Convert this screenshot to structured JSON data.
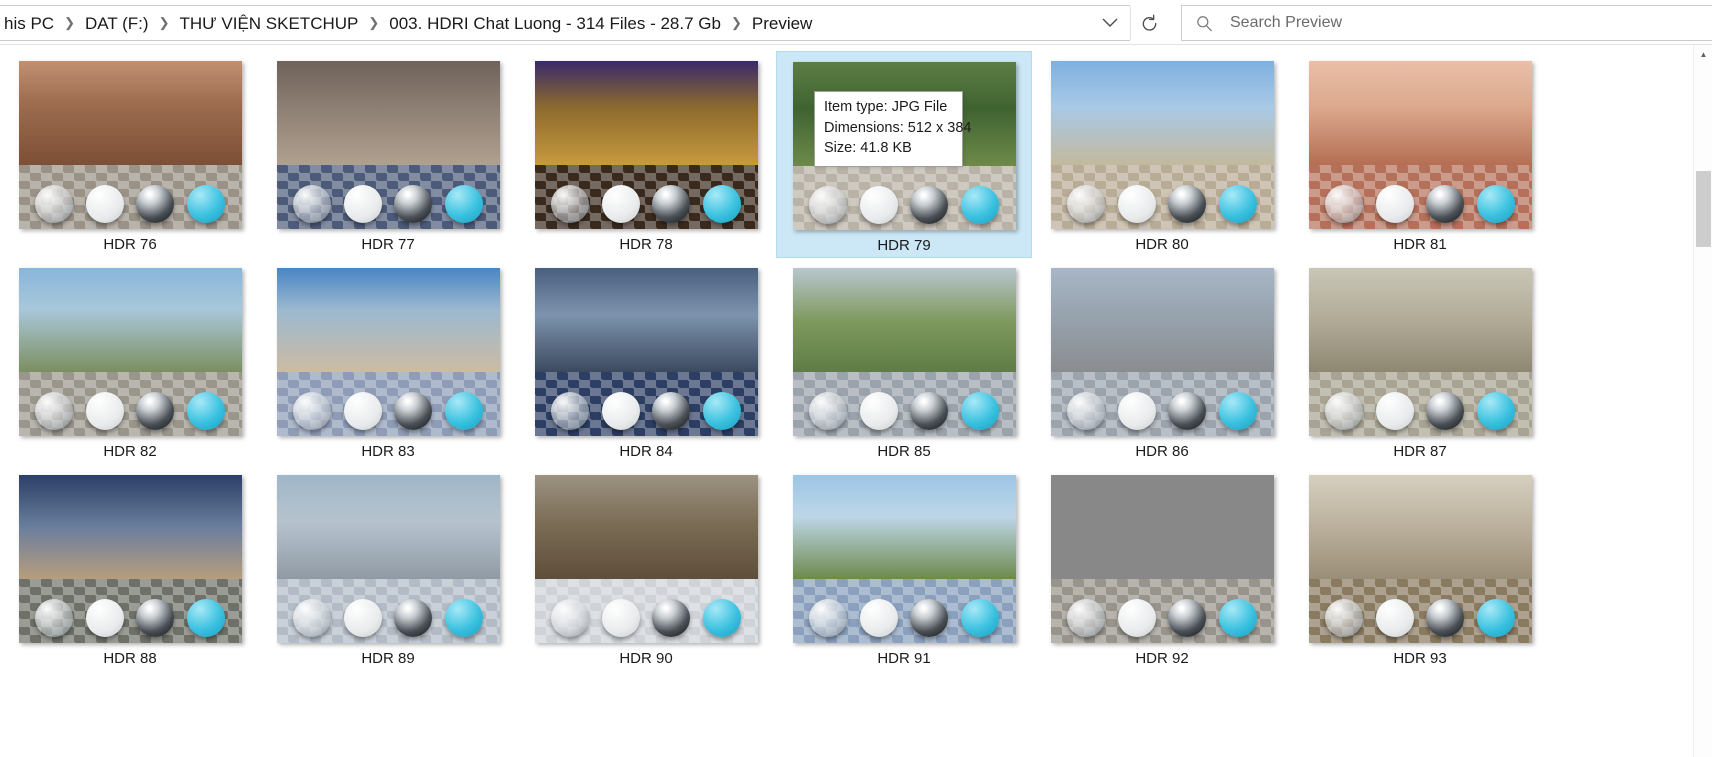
{
  "addressbar": {
    "breadcrumbs": [
      {
        "label": "his PC"
      },
      {
        "label": "DAT  (F:)"
      },
      {
        "label": "THƯ VIỆN SKETCHUP"
      },
      {
        "label": "003. HDRI Chat Luong - 314 Files - 28.7 Gb"
      },
      {
        "label": "Preview"
      }
    ],
    "separator": "❯",
    "dropdown_icon": "chevron-down",
    "refresh_icon": "refresh"
  },
  "search": {
    "placeholder": "Search Preview",
    "value": "",
    "icon": "search-icon"
  },
  "tooltip": {
    "item_type": "Item type: JPG File",
    "dimensions": "Dimensions: 512 x 384",
    "size": "Size: 41.8 KB"
  },
  "scrollbar": {
    "up_arrow": "▲",
    "position_pct": 18
  },
  "grid": {
    "rows": [
      [
        {
          "label": "HDR 76",
          "selected": false,
          "sky": "linear-gradient(180deg,#c09071,#9e6d50 40%,#7d4f36)",
          "ground": "#9a9287"
        },
        {
          "label": "HDR 77",
          "selected": false,
          "sky": "linear-gradient(180deg,#6f625a,#8d7f73 45%,#b0a08f)",
          "ground": "#4d5b7a"
        },
        {
          "label": "HDR 78",
          "selected": false,
          "sky": "linear-gradient(180deg,#3a2a6b,#8d6a2e 45%,#c79a3d)",
          "ground": "#3a2a1e"
        },
        {
          "label": "HDR 79",
          "selected": true,
          "sky": "linear-gradient(180deg,#5d7d45,#3f6330 45%,#6d8a4a)",
          "ground": "#b9b2a6"
        },
        {
          "label": "HDR 80",
          "selected": false,
          "sky": "linear-gradient(180deg,#7fb0e0,#a9c9e6 45%,#c3b99d)",
          "ground": "#b9ac96"
        },
        {
          "label": "HDR 81",
          "selected": false,
          "sky": "linear-gradient(180deg,#e9bfa7,#dba88d 45%,#b56e53)",
          "ground": "#b5705a"
        }
      ],
      [
        {
          "label": "HDR 82",
          "selected": false,
          "sky": "linear-gradient(180deg,#88b6dc,#a9c7d9 40%,#7c8f60)",
          "ground": "#9b968c"
        },
        {
          "label": "HDR 83",
          "selected": false,
          "sky": "linear-gradient(180deg,#4a84c4,#9bb9cf 40%,#cdbba2)",
          "ground": "#8e9cb7"
        },
        {
          "label": "HDR 84",
          "selected": false,
          "sky": "linear-gradient(180deg,#4a5f7e,#7d93ad 45%,#3c4a60)",
          "ground": "#2c3e63"
        },
        {
          "label": "HDR 85",
          "selected": false,
          "sky": "linear-gradient(180deg,#b9c6cf,#7f9a5f 50%,#5e7c45)",
          "ground": "#9aa2ab"
        },
        {
          "label": "HDR 86",
          "selected": false,
          "sky": "linear-gradient(180deg,#a8b6c6,#97a3ae 45%,#8a8d90)",
          "ground": "#9ba3ad"
        },
        {
          "label": "HDR 87",
          "selected": false,
          "sky": "linear-gradient(180deg,#c9c6b6,#b4ae9b 45%,#8e8873)",
          "ground": "#a8a392"
        }
      ],
      [
        {
          "label": "HDR 88",
          "selected": false,
          "sky": "linear-gradient(180deg,#2b3f68,#6a7e9c 50%,#b79d7d)",
          "ground": "#6f7168"
        },
        {
          "label": "HDR 89",
          "selected": false,
          "sky": "linear-gradient(180deg,#9fb6c9,#b6c3ce 45%,#8f9aa4)",
          "ground": "#b3bcc6"
        },
        {
          "label": "HDR 90",
          "selected": false,
          "sky": "linear-gradient(180deg,#9c9382,#7c6d56 45%,#5e4e3b)",
          "ground": "#cfd3d8"
        },
        {
          "label": "HDR 91",
          "selected": false,
          "sky": "linear-gradient(180deg,#9cc6e6,#bdd6e8 40%,#6d8a4a)",
          "ground": "#8aa0bd"
        },
        {
          "label": "HDR 92",
          "selected": false,
          "sky": "linear-gradient(180deg,#7ba8cd,#6d8f4f 40%,#b4estub)",
          "ground": "#98948b"
        },
        {
          "label": "HDR 93",
          "selected": false,
          "sky": "linear-gradient(180deg,#d6cfc0,#bdb3a0 45%,#9b8e78)",
          "ground": "#8a7a60"
        }
      ]
    ],
    "sphere_kinds": [
      "glass",
      "white",
      "chrome",
      "cyan"
    ]
  }
}
